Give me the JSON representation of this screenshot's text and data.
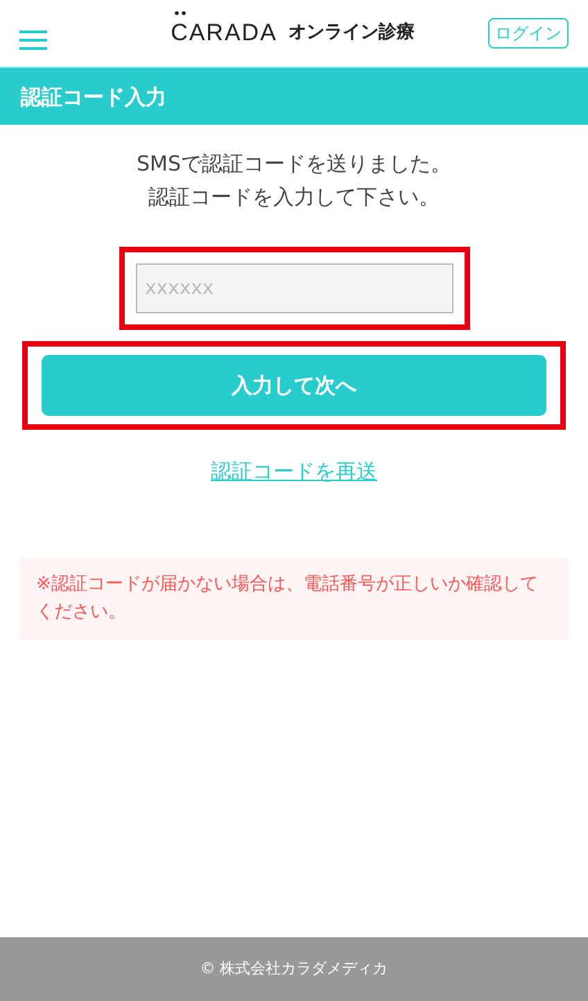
{
  "header": {
    "logo": "CARADA",
    "logo_subtitle": "オンライン診療",
    "login_button": "ログイン"
  },
  "page_title": "認証コード入力",
  "message_lines": [
    "SMSで認証コードを送りました。",
    "認証コードを入力して下さい。"
  ],
  "code_field": {
    "placeholder": "xxxxxx",
    "highlighted": true
  },
  "submit_button": {
    "label": "入力して次へ",
    "highlighted": true
  },
  "resend_link": "認証コードを再送",
  "notice": "※認証コードが届かない場合は、電話番号が正しいか確認してください。",
  "footer": "© 株式会社カラダメディカ"
}
